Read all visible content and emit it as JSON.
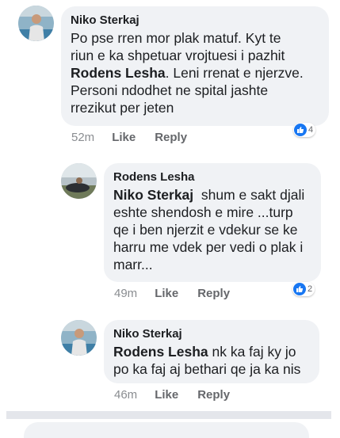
{
  "comments": [
    {
      "author": "Niko Sterkaj",
      "text_lines": [
        "Po pse rren mor plak matuf. Kyt te",
        "riun e  ka shpetuar vrojtuesi i pazhit",
        {
          "mention": "Rodens Lesha",
          "rest": ". Leni rrenat e njerzve."
        },
        "Personi ndodhet ne spital jashte",
        "rrezikut per jeten"
      ],
      "time": "52m",
      "like_label": "Like",
      "reply_label": "Reply",
      "reaction_count": "4"
    },
    {
      "author": "Rodens Lesha",
      "mention": "Niko Sterkaj",
      "text_after_mention": "  shum e sakt djali",
      "text_lines": [
        "eshte shendosh e mire ...turp",
        "qe i ben njerzit e vdekur se ke",
        "harru me vdek per vedi o plak i",
        "marr..."
      ],
      "time": "49m",
      "like_label": "Like",
      "reply_label": "Reply",
      "reaction_count": "2"
    },
    {
      "author": "Niko Sterkaj",
      "mention": "Rodens Lesha",
      "text_after_mention": " nk ka faj ky jo",
      "text_lines": [
        "po ka faj aj bethari qe ja ka nis"
      ],
      "time": "46m",
      "like_label": "Like",
      "reply_label": "Reply"
    }
  ],
  "colors": {
    "bubble": "#f0f2f5",
    "like_blue": "#1877f2",
    "meta_gray": "#65676b"
  }
}
